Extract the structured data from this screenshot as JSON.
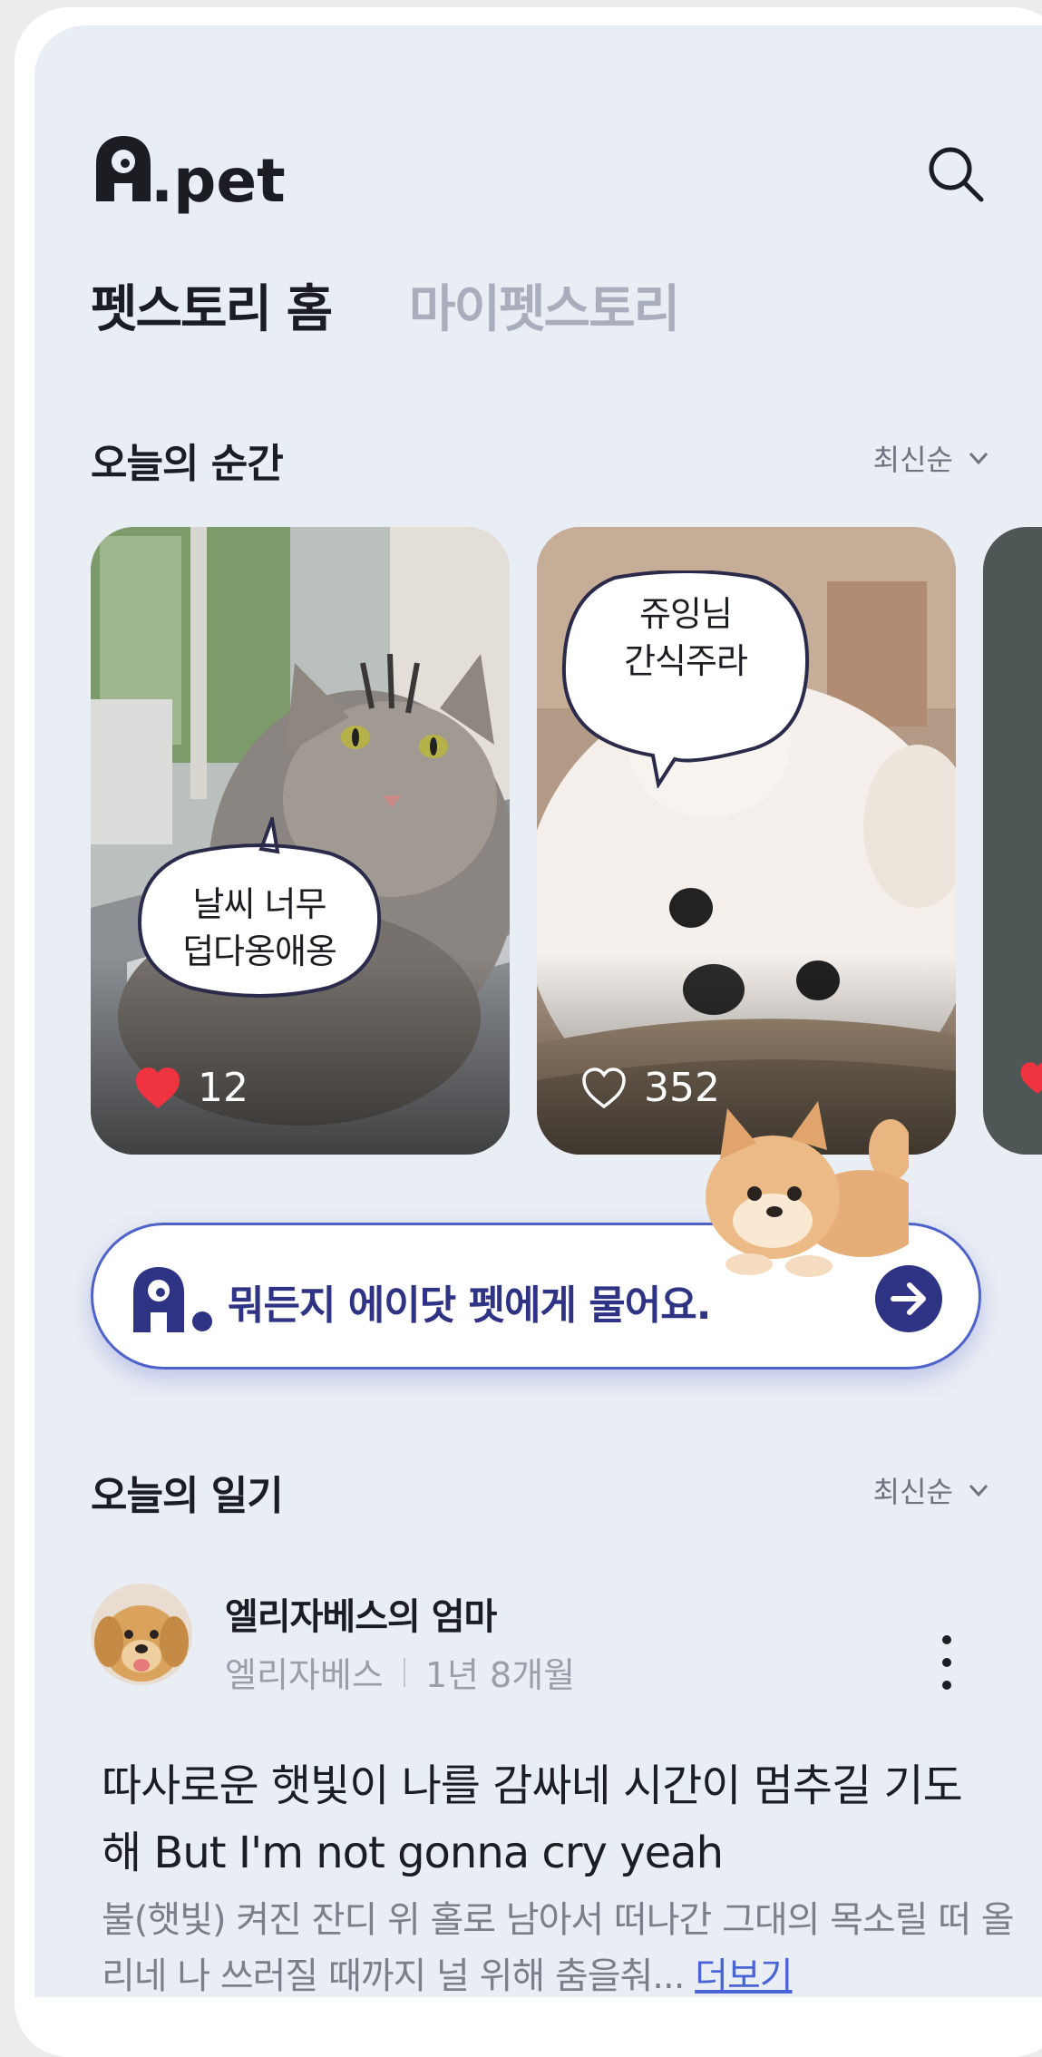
{
  "header": {
    "logo_text": "A.pet",
    "search_icon": "search-icon"
  },
  "tabs": [
    {
      "label": "펫스토리 홈",
      "active": true
    },
    {
      "label": "마이펫스토리",
      "active": false
    }
  ],
  "moments": {
    "title": "오늘의 순간",
    "sort_label": "최신순",
    "cards": [
      {
        "bubble": "날씨 너무\n덥다옹애옹",
        "likes": "12",
        "liked": true
      },
      {
        "bubble": "쥬잉님\n간식주라",
        "likes": "352",
        "liked": false
      }
    ]
  },
  "ask_bar": {
    "placeholder": "뭐든지 에이닷 펫에게 물어요.",
    "go_icon": "arrow-right-icon"
  },
  "diary": {
    "title": "오늘의 일기",
    "sort_label": "최신순",
    "post": {
      "author": "엘리자베스의 엄마",
      "pet_name": "엘리자베스",
      "age": "1년 8개월",
      "title": "따사로운 햇빛이 나를 감싸네 시간이 멈추길 기도해 But I'm not gonna cry yeah",
      "excerpt": "불(햇빛) 켜진 잔디 위 홀로 남아서 떠나간 그대의 목소릴 떠 올리네 나 쓰러질 때까지 널 위해 춤을춰...",
      "read_more": "더보기"
    }
  },
  "colors": {
    "background": "#e9edf4",
    "accent": "#2e3383",
    "ask_border": "#4f62c9",
    "like_red": "#ef3340",
    "link": "#4a64d6"
  }
}
